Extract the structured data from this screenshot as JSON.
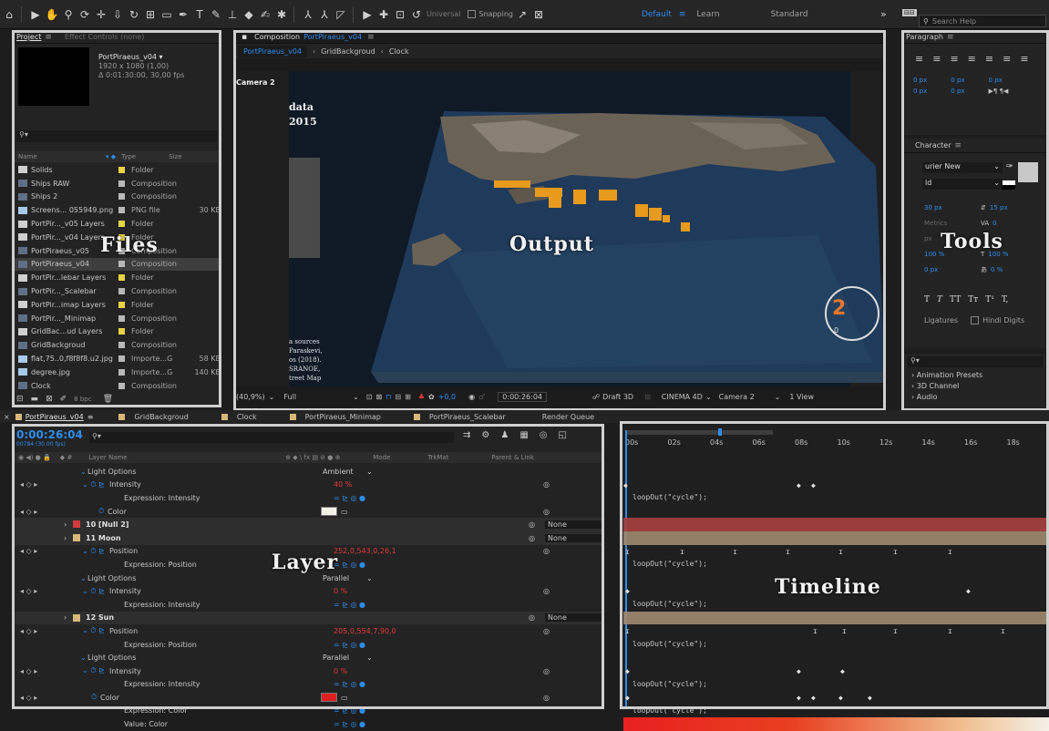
{
  "toolbar": {
    "universal_label": "Universal",
    "snapping_label": "Snapping",
    "workspaces": [
      "Default",
      "Learn",
      "Standard"
    ],
    "search_placeholder": "Search Help"
  },
  "project_panel": {
    "tab_project": "Project",
    "tab_effect_controls": "Effect Controls (none)",
    "comp_name": "PortPiraeus_v04",
    "comp_res": "1920 x 1080 (1,00)",
    "comp_dur": "Δ 0:01:30:00, 30,00 fps",
    "columns": {
      "name": "Name",
      "type": "Type",
      "size": "Size"
    },
    "items": [
      {
        "name": "Solids",
        "type": "Folder",
        "size": "",
        "color": "#e6d443",
        "kind": "folder"
      },
      {
        "name": "Ships RAW",
        "type": "Composition",
        "size": "",
        "color": "#b8b8b8",
        "kind": "comp"
      },
      {
        "name": "Ships 2",
        "type": "Composition",
        "size": "",
        "color": "#b8b8b8",
        "kind": "comp"
      },
      {
        "name": "Screens... 055949.png",
        "type": "PNG file",
        "size": "30 KB",
        "color": "#b8b8b8",
        "kind": "file"
      },
      {
        "name": "PortPir..._v05 Layers",
        "type": "Folder",
        "size": "",
        "color": "#e6d443",
        "kind": "folder"
      },
      {
        "name": "PortPir..._v04 Layers",
        "type": "Folder",
        "size": "",
        "color": "#e6d443",
        "kind": "folder"
      },
      {
        "name": "PortPiraeus_v05",
        "type": "Composition",
        "size": "",
        "color": "#b8b8b8",
        "kind": "comp"
      },
      {
        "name": "PortPiraeus_v04",
        "type": "Composition",
        "size": "",
        "color": "#b8b8b8",
        "kind": "comp",
        "selected": true
      },
      {
        "name": "PortPir...lebar Layers",
        "type": "Folder",
        "size": "",
        "color": "#e6d443",
        "kind": "folder"
      },
      {
        "name": "PortPir..._Scalebar",
        "type": "Composition",
        "size": "",
        "color": "#b8b8b8",
        "kind": "comp"
      },
      {
        "name": "PortPir...imap Layers",
        "type": "Folder",
        "size": "",
        "color": "#e6d443",
        "kind": "folder"
      },
      {
        "name": "PortPir..._Minimap",
        "type": "Composition",
        "size": "",
        "color": "#b8b8b8",
        "kind": "comp"
      },
      {
        "name": "GridBac...ud Layers",
        "type": "Folder",
        "size": "",
        "color": "#e6d443",
        "kind": "folder"
      },
      {
        "name": "GridBackgroud",
        "type": "Composition",
        "size": "",
        "color": "#b8b8b8",
        "kind": "comp"
      },
      {
        "name": "flat,75..0,f8f8f8.u2.jpg",
        "type": "Importe...G",
        "size": "58 KB",
        "color": "#b8b8b8",
        "kind": "file"
      },
      {
        "name": "degree.jpg",
        "type": "Importe...G",
        "size": "140 KB",
        "color": "#b8b8b8",
        "kind": "file"
      },
      {
        "name": "Clock",
        "type": "Composition",
        "size": "",
        "color": "#b8b8b8",
        "kind": "comp"
      }
    ],
    "bpc": "8 bpc",
    "label": "Files"
  },
  "composition": {
    "panel_title": "Composition",
    "panel_comp": "PortPiraeus_v04",
    "tabs": [
      "PortPiraeus_v04",
      "GridBackgroud",
      "Clock"
    ],
    "camera_label": "Camera 2",
    "overlay_lines": [
      "data",
      "2015"
    ],
    "source_lines": [
      "a sources",
      "Paraskevi,",
      "os (2018).",
      "SRANOE,",
      "treet Map"
    ],
    "gauge_digit": "2",
    "gauge_small": "0",
    "label": "Output",
    "footer": {
      "zoom": "(40,9%)",
      "quality": "Full",
      "exposure": "+0,0",
      "timecode": "0:00:26:04",
      "renderer": "Draft 3D",
      "engine": "CINEMA 4D",
      "camera": "Camera 2",
      "view": "1 View"
    },
    "legend_colors": [
      "#e8762a",
      "#d43a3a",
      "#2d8ceb",
      "#3fb44a",
      "#c84ed0",
      "#c8c8c8"
    ]
  },
  "paragraph": {
    "title": "Paragraph",
    "px": [
      "0 px",
      "0 px",
      "0 px",
      "0 px",
      "0 px"
    ]
  },
  "character": {
    "title": "Character",
    "font": "urier New",
    "style": "ld",
    "size": "30 px",
    "leading": "15 px",
    "metrics": "Metrics",
    "tracking": "0",
    "scale_v": "100 %",
    "scale_h": "100 %",
    "baseline": "0 px",
    "tsume": "0 %",
    "ligatures": "Ligatures",
    "hindi": "Hindi Digits",
    "px_label": "px",
    "label": "Tools",
    "extra": [
      "Animation Presets",
      "3D Channel",
      "Audio"
    ]
  },
  "timeline_tabs": [
    "PortPiraeus_v04",
    "GridBackgroud",
    "Clock",
    "PortPiraeus_Minimap",
    "PortPiraeus_Scalebar",
    "Render Queue"
  ],
  "timeline_tab_colors": [
    "#d8b878",
    "#d8b878",
    "#d8b878",
    "#d8b878",
    "#d8b878"
  ],
  "current_time": "0:00:26:04",
  "current_frames": "00784 (30.00 fps)",
  "layer_header": {
    "layer_name": "Layer Name",
    "mode": "Mode",
    "trkmat": "TrkMat",
    "parent": "Parent & Link"
  },
  "layers": [
    {
      "indent": 82,
      "text": "Light Options",
      "val": "Ambient",
      "type": "group"
    },
    {
      "indent": 96,
      "text": "Intensity",
      "val": "40 %",
      "valRed": true,
      "type": "prop"
    },
    {
      "indent": 122,
      "text": "Expression: Intensity",
      "val": "",
      "type": "expr"
    },
    {
      "indent": 104,
      "text": "Color",
      "val": "",
      "type": "color",
      "swatch": "#f4f1e8"
    },
    {
      "indent": 70,
      "text": "10   [Null 2]",
      "val": "",
      "type": "layer",
      "labelColor": "#d43a3a",
      "parent": "None"
    },
    {
      "indent": 70,
      "text": "11   Moon",
      "val": "",
      "type": "layer",
      "labelColor": "#d8b878",
      "parent": "None"
    },
    {
      "indent": 96,
      "text": "Position",
      "val": "252,0,543,0,26,1",
      "valRed": true,
      "type": "prop"
    },
    {
      "indent": 122,
      "text": "Expression: Position",
      "val": "",
      "type": "expr"
    },
    {
      "indent": 82,
      "text": "Light Options",
      "val": "Parallel",
      "type": "group"
    },
    {
      "indent": 96,
      "text": "Intensity",
      "val": "0 %",
      "valRed": true,
      "type": "prop"
    },
    {
      "indent": 122,
      "text": "Expression: Intensity",
      "val": "",
      "type": "expr"
    },
    {
      "indent": 70,
      "text": "12   Sun",
      "val": "",
      "type": "layer",
      "labelColor": "#d8b878",
      "parent": "None"
    },
    {
      "indent": 96,
      "text": "Position",
      "val": "205,0,554,7,90,0",
      "valRed": true,
      "type": "prop"
    },
    {
      "indent": 122,
      "text": "Expression: Position",
      "val": "",
      "type": "expr"
    },
    {
      "indent": 82,
      "text": "Light Options",
      "val": "Parallel",
      "type": "group"
    },
    {
      "indent": 96,
      "text": "Intensity",
      "val": "0 %",
      "valRed": true,
      "type": "prop"
    },
    {
      "indent": 122,
      "text": "Expression: Intensity",
      "val": "",
      "type": "expr"
    },
    {
      "indent": 96,
      "text": "Color",
      "val": "",
      "type": "color",
      "swatch": "#e02020"
    },
    {
      "indent": 122,
      "text": "Expression: Color",
      "val": "",
      "type": "expr"
    },
    {
      "indent": 122,
      "text": "Value: Color",
      "val": "",
      "type": "expr"
    }
  ],
  "layer_label": "Layer",
  "timeline_ruler": [
    "00s",
    "02s",
    "04s",
    "06s",
    "08s",
    "10s",
    "12s",
    "14s",
    "16s",
    "18s"
  ],
  "expression_text": "loopOut(\"cycle\");",
  "timeline_label": "Timeline"
}
